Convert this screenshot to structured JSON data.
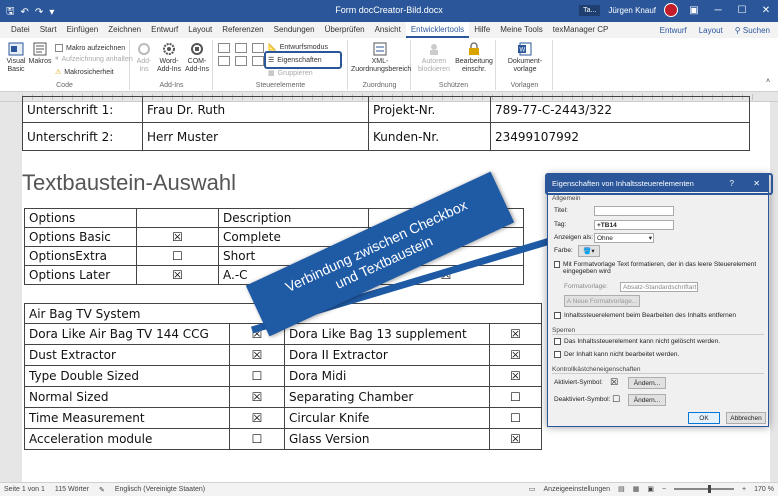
{
  "titlebar": {
    "title": "Form docCreator-Bild.docx",
    "badge": "Ta...",
    "user": "Jürgen Knauf"
  },
  "tabs": [
    "Datei",
    "Start",
    "Einfügen",
    "Zeichnen",
    "Entwurf",
    "Layout",
    "Referenzen",
    "Sendungen",
    "Überprüfen",
    "Ansicht",
    "Entwicklertools",
    "Hilfe",
    "Meine Tools",
    "texManager CP"
  ],
  "active_tab": "Entwicklertools",
  "tabs_right": [
    "Entwurf",
    "Layout",
    "Suchen"
  ],
  "ribbon": {
    "code": {
      "label": "Code",
      "visual_basic": "Visual Basic",
      "makros": "Makros",
      "makro_aufzeichnen": "Makro aufzeichnen",
      "aufzeichnung_anhalten": "Aufzeichnung anhalten",
      "makrosicherheit": "Makrosicherheit"
    },
    "addins": {
      "label": "Add-Ins",
      "addins": "Add-Ins",
      "word_addins": "Word-Add-Ins",
      "com_addins": "COM-Add-Ins"
    },
    "steuerelemente": {
      "label": "Steuerelemente",
      "entwurfsmodus": "Entwurfsmodus",
      "eigenschaften": "Eigenschaften",
      "gruppieren": "Gruppieren"
    },
    "zuordnung": {
      "label": "Zuordnung",
      "xml": "XML-Zuordnungsbereich"
    },
    "schuetzen": {
      "label": "Schützen",
      "autoren": "Autoren blockieren",
      "bearbeitung": "Bearbeitung einschr."
    },
    "vorlagen": {
      "label": "Vorlagen",
      "dokumentvorlage": "Dokument-vorlage"
    }
  },
  "doc": {
    "top_table": [
      [
        "Unterschrift 1:",
        "Frau Dr. Ruth",
        "Projekt-Nr.",
        "789-77-C-2443/322"
      ],
      [
        "Unterschrift 2:",
        "Herr Muster",
        "Kunden-Nr.",
        "23499107992"
      ]
    ],
    "heading": "Textbaustein-Auswahl",
    "options_table": {
      "header": [
        "Options",
        "",
        "Description",
        ""
      ],
      "rows": [
        [
          "Options Basic",
          "☒",
          "Complete",
          ""
        ],
        [
          "OptionsExtra",
          "☐",
          "Short",
          ""
        ],
        [
          "Options Later",
          "☒",
          "A.-C",
          "☒"
        ]
      ]
    },
    "equip_table": {
      "title": "Air Bag TV System",
      "rows": [
        [
          "Dora Like Air Bag TV 144 CCG",
          "☒",
          "Dora Like Bag 13 supplement",
          "☒"
        ],
        [
          "Dust Extractor",
          "☒",
          "Dora II Extractor",
          "☒"
        ],
        [
          "Type Double Sized",
          "☐",
          "Dora Midi",
          "☒"
        ],
        [
          "Normal Sized",
          "☒",
          "Separating Chamber",
          "☐"
        ],
        [
          "Time Measurement",
          "☒",
          "Circular Knife",
          "☐"
        ],
        [
          "Acceleration module",
          "☐",
          "Glass Version",
          "☒"
        ]
      ]
    }
  },
  "callout": {
    "line1": "Verbindung zwischen Checkbox",
    "line2": "und Textbaustein",
    "color": "#1f5aa5"
  },
  "dialog": {
    "title": "Eigenschaften von Inhaltssteuerelementen",
    "help": "?",
    "close": "✕",
    "allgemein": "Allgemein",
    "titel_label": "Titel:",
    "titel_value": "",
    "tag_label": "Tag:",
    "tag_value": "+TB14",
    "anzeigen_label": "Anzeigen als:",
    "anzeigen_value": "Ohne",
    "farbe_label": "Farbe:",
    "formatvorlage_check": "Mit Formatvorlage Text formatieren, der in das leere Steuerelement eingegeben wird",
    "formatvorlage_label": "Formatvorlage:",
    "formatvorlage_value": "Absatz-Standardschriftart",
    "neue_formatvorlage": "Neue Formatvorlage...",
    "entfernen_check": "Inhaltssteuerelement beim Bearbeiten des Inhalts entfernen",
    "sperren": "Sperren",
    "sperren_1": "Das Inhaltssteuerelement kann nicht gelöscht werden.",
    "sperren_2": "Der Inhalt kann nicht bearbeitet werden.",
    "kontroll": "Kontrollkästcheneigenschaften",
    "aktiviert_label": "Aktiviert-Symbol:",
    "aktiviert_symbol": "☒",
    "deaktiviert_label": "Deaktiviert-Symbol:",
    "deaktiviert_symbol": "☐",
    "aendern": "Ändern...",
    "ok": "OK",
    "abbrechen": "Abbrechen"
  },
  "statusbar": {
    "seite": "Seite 1 von 1",
    "woerter": "115 Wörter",
    "sprache": "Englisch (Vereinigte Staaten)",
    "anzeige": "Anzeigeeinstellungen",
    "zoom": "170 %"
  }
}
